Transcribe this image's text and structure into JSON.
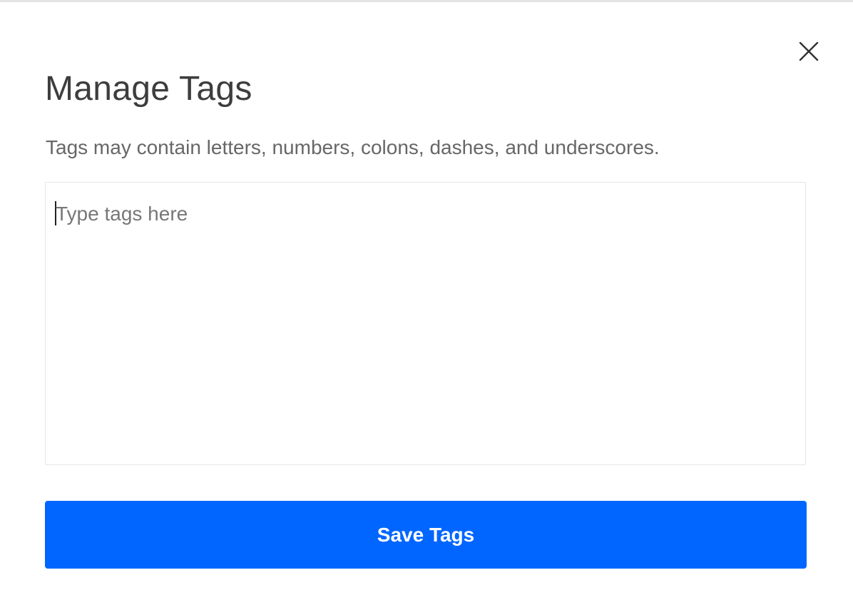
{
  "modal": {
    "title": "Manage Tags",
    "hint": "Tags may contain letters, numbers, colons, dashes, and underscores.",
    "close_icon": "close-icon",
    "tags_input": {
      "value": "",
      "placeholder": "Type tags here"
    },
    "save_label": "Save Tags"
  },
  "colors": {
    "accent": "#0066ff",
    "title": "#3d3d3d",
    "hint": "#676767",
    "border": "#e6e6e6"
  }
}
